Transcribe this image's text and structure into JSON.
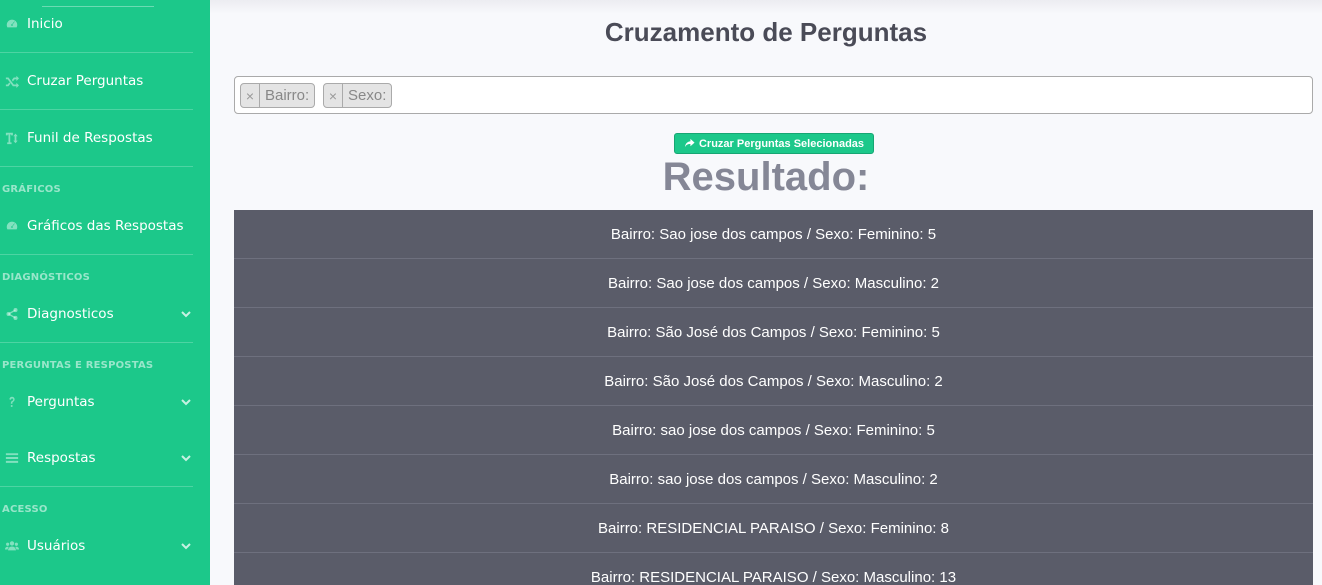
{
  "sidebar": {
    "items": [
      {
        "label": "Inicio",
        "icon": "tachometer-icon"
      },
      {
        "label": "Cruzar Perguntas",
        "icon": "random-icon"
      },
      {
        "label": "Funil de Respostas",
        "icon": "text-height-icon"
      }
    ],
    "sections": [
      {
        "heading": "GRÁFICOS",
        "items": [
          {
            "label": "Gráficos das Respostas",
            "icon": "tachometer-icon"
          }
        ]
      },
      {
        "heading": "DIAGNÓSTICOS",
        "items": [
          {
            "label": "Diagnosticos",
            "icon": "share-alt-icon"
          }
        ]
      },
      {
        "heading": "PERGUNTAS E RESPOSTAS",
        "items": [
          {
            "label": "Perguntas",
            "icon": "question-icon"
          },
          {
            "label": "Respostas",
            "icon": "list-icon"
          }
        ]
      },
      {
        "heading": "ACESSO",
        "items": [
          {
            "label": "Usuários",
            "icon": "users-icon"
          }
        ]
      }
    ]
  },
  "main": {
    "title": "Cruzamento de Perguntas",
    "tags": [
      {
        "label": "Bairro:",
        "remove": "×"
      },
      {
        "label": "Sexo:",
        "remove": "×"
      }
    ],
    "cross_button": "Cruzar Perguntas Selecionadas",
    "result_title": "Resultado:",
    "results": [
      "Bairro: Sao jose dos campos / Sexo: Feminino: 5",
      "Bairro: Sao jose dos campos / Sexo: Masculino: 2",
      "Bairro: São José dos Campos / Sexo: Feminino: 5",
      "Bairro: São José dos Campos / Sexo: Masculino: 2",
      "Bairro: sao jose dos campos / Sexo: Feminino: 5",
      "Bairro: sao jose dos campos / Sexo: Masculino: 2",
      "Bairro: RESIDENCIAL PARAISO / Sexo: Feminino: 8",
      "Bairro: RESIDENCIAL PARAISO / Sexo: Masculino: 13"
    ]
  },
  "colors": {
    "sidebar": "#1cc88a",
    "result_bg": "#5a5c69",
    "page_bg": "#f8f9fc"
  }
}
